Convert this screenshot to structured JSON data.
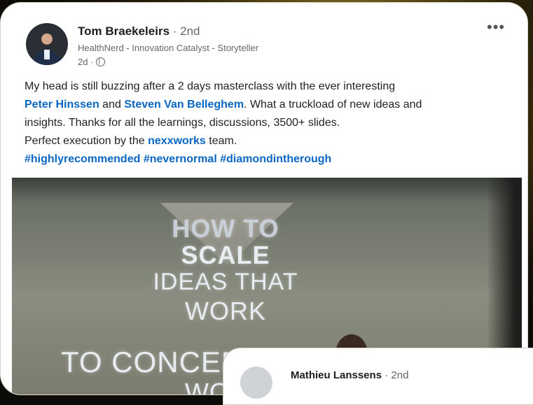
{
  "post": {
    "author": {
      "name": "Tom Braekeleirs",
      "degree": "· 2nd",
      "headline": "HealthNerd - Innovation Catalyst - Storyteller",
      "time": "2d ·",
      "visibility_icon": "globe-icon",
      "more_label": "•••"
    },
    "text": {
      "line1": "My head is still buzzing after a 2 days masterclass with the ever interesting",
      "mention1": "Peter Hinssen",
      "and": " and ",
      "mention2": "Steven Van Belleghem",
      "line2_rest": ". What a truckload of new ideas and",
      "line3": "insights. Thanks for all the learnings, discussions, 3500+ slides.",
      "line4_start": "Perfect execution by the ",
      "mention3": "nexxworks",
      "line4_end": " team.",
      "hashtag1": "#highlyrecommended",
      "hashtag2": "#nevernormal",
      "hashtag3": "#diamondintherough"
    },
    "image": {
      "slide_line1": "HOW TO",
      "slide_line2": "SCALE",
      "slide_line3": "IDEAS THAT",
      "slide_line4": "WORK",
      "slide_line5": "TO CONCEPTS THAT",
      "slide_line6": "WORK"
    }
  },
  "next_post": {
    "author_name": "Mathieu Lanssens",
    "degree": "· 2nd"
  },
  "colors": {
    "link": "#0a66c2",
    "text": "#222222",
    "muted": "#666666",
    "background": "#0d0b07"
  }
}
